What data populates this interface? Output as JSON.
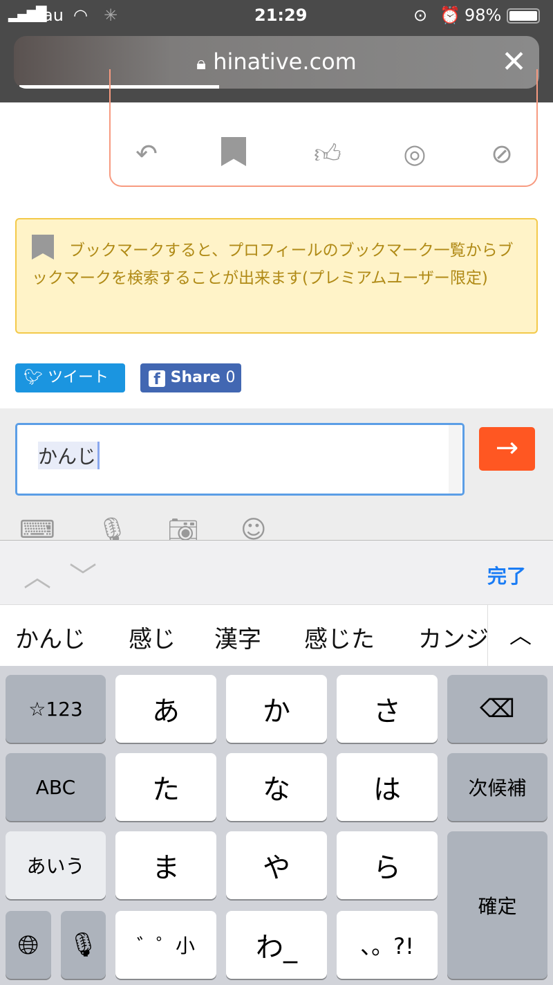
{
  "status_bar": {
    "carrier": "au",
    "time": "21:29",
    "battery": "98%"
  },
  "browser": {
    "url": "hinative.com",
    "progress": 0.38
  },
  "actions": [
    "reply",
    "bookmark",
    "like",
    "rolling-eyes",
    "block"
  ],
  "notice": {
    "text": "ブックマークすると、プロフィールのブックマーク一覧からブックマークを検索することが出来ます(プレミアムユーザー限定)"
  },
  "share": {
    "tweet": "ツイート",
    "facebook": "Share",
    "facebook_count": "0"
  },
  "composer": {
    "value": "かんじ"
  },
  "accessory": {
    "done": "完了"
  },
  "candidates": [
    "かんじ",
    "感じ",
    "漢字",
    "感じた",
    "カンジ"
  ],
  "keyboard": {
    "row1": [
      "☆123",
      "あ",
      "か",
      "さ",
      "⌫"
    ],
    "row2": [
      "ABC",
      "た",
      "な",
      "は",
      "次候補"
    ],
    "row3": [
      "あいう",
      "ま",
      "や",
      "ら"
    ],
    "row4": [
      "゛゜小",
      "わ_",
      "、。?!"
    ],
    "confirm": "確定"
  },
  "colors": {
    "accent": "#ff5722",
    "twitter": "#1b95e0",
    "facebook": "#4267b2",
    "ios_blue": "#1a7cf5"
  }
}
